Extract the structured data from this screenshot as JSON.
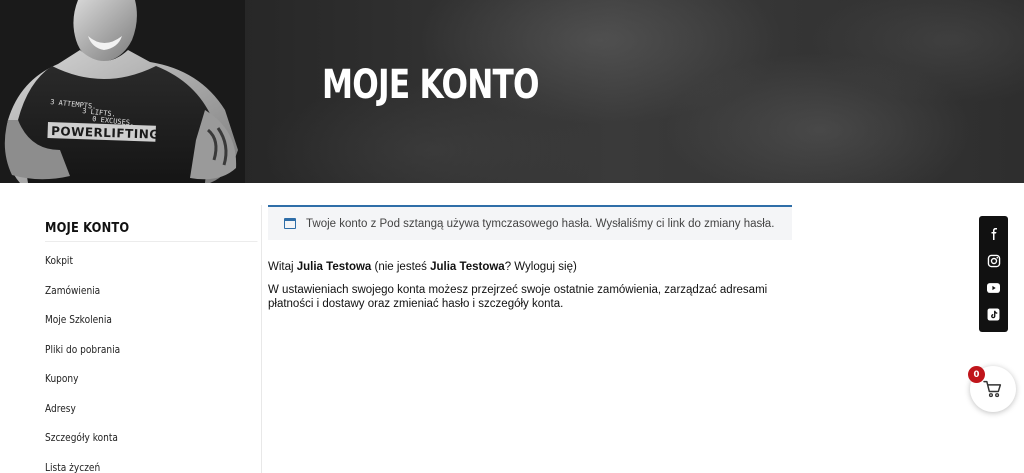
{
  "hero": {
    "title": "MOJE KONTO",
    "shirt_text_line1": "3 ATTEMPTS.",
    "shirt_text_line2": "3 LIFTS.",
    "shirt_text_line3": "0 EXCUSES.",
    "shirt_brand": "POWERLIFTING"
  },
  "sidebar": {
    "heading": "MOJE KONTO",
    "items": [
      {
        "label": "Kokpit"
      },
      {
        "label": "Zamówienia"
      },
      {
        "label": "Moje Szkolenia"
      },
      {
        "label": "Pliki do pobrania"
      },
      {
        "label": "Kupony"
      },
      {
        "label": "Adresy"
      },
      {
        "label": "Szczegóły konta"
      },
      {
        "label": "Lista życzeń"
      }
    ]
  },
  "notice": {
    "text": "Twoje konto z Pod sztangą używa tymczasowego hasła. Wysłaliśmy ci link do zmiany hasła.",
    "icon": "window-icon"
  },
  "greeting": {
    "prefix": "Witaj ",
    "user": "Julia Testowa",
    "middle": " (nie jesteś ",
    "user2": "Julia Testowa",
    "q": "? ",
    "logout": "Wyloguj się",
    "suffix": ")"
  },
  "description": {
    "part1": "W ustawieniach swojego konta możesz przejrzeć swoje ",
    "link1": "ostatnie zamówienia",
    "part2": ", zarządzać ",
    "link2": "adresami płatności i dostawy",
    "part3": " oraz ",
    "link3": "zmieniać hasło i szczegóły konta",
    "part4": "."
  },
  "social": {
    "items": [
      "facebook-icon",
      "instagram-icon",
      "youtube-icon",
      "tiktok-icon"
    ]
  },
  "cart": {
    "count": "0",
    "badge_color": "#c0151b"
  },
  "colors": {
    "accent": "#2f6ea8",
    "social_bg": "#111111"
  }
}
